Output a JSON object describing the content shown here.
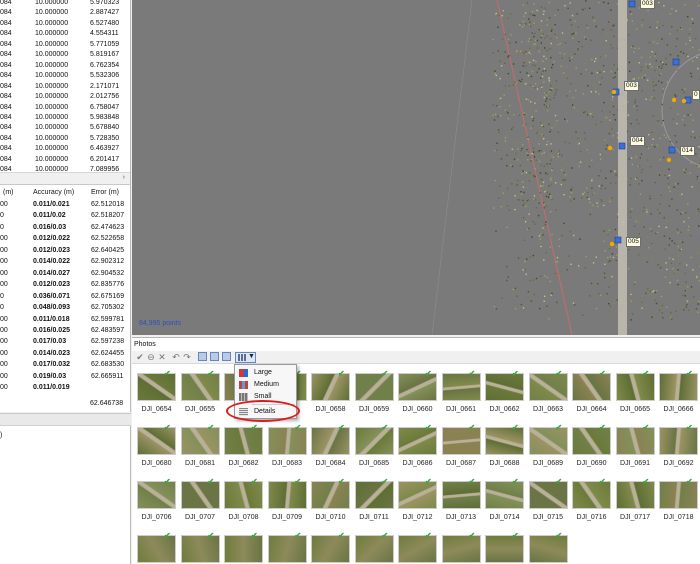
{
  "left_top_rows": [
    {
      "c1": "084",
      "c2": "10.000000",
      "c3": "5.970323"
    },
    {
      "c1": "084",
      "c2": "10.000000",
      "c3": "2.887427"
    },
    {
      "c1": "084",
      "c2": "10.000000",
      "c3": "6.527480"
    },
    {
      "c1": "084",
      "c2": "10.000000",
      "c3": "4.554311"
    },
    {
      "c1": "084",
      "c2": "10.000000",
      "c3": "5.771059"
    },
    {
      "c1": "084",
      "c2": "10.000000",
      "c3": "5.819167"
    },
    {
      "c1": "084",
      "c2": "10.000000",
      "c3": "6.762354"
    },
    {
      "c1": "084",
      "c2": "10.000000",
      "c3": "5.532306"
    },
    {
      "c1": "084",
      "c2": "10.000000",
      "c3": "2.171071"
    },
    {
      "c1": "084",
      "c2": "10.000000",
      "c3": "2.012756"
    },
    {
      "c1": "084",
      "c2": "10.000000",
      "c3": "6.758047"
    },
    {
      "c1": "084",
      "c2": "10.000000",
      "c3": "5.983848"
    },
    {
      "c1": "084",
      "c2": "10.000000",
      "c3": "5.678840"
    },
    {
      "c1": "084",
      "c2": "10.000000",
      "c3": "5.728350"
    },
    {
      "c1": "084",
      "c2": "10.000000",
      "c3": "6.463927"
    },
    {
      "c1": "084",
      "c2": "10.000000",
      "c3": "6.201417"
    },
    {
      "c1": "084",
      "c2": "10.000000",
      "c3": "7.089956"
    }
  ],
  "left_top_scroll_arrow": "›",
  "gcp_table": {
    "headers": {
      "c1": "(m)",
      "c2": "Accuracy (m)",
      "c3": "Error (m)"
    },
    "rows": [
      {
        "c1": "00",
        "c2": "0.011/0.021",
        "c3": "62.512018"
      },
      {
        "c1": "0",
        "c2": "0.011/0.02",
        "c3": "62.518207"
      },
      {
        "c1": "0",
        "c2": "0.016/0.03",
        "c3": "62.474623"
      },
      {
        "c1": "00",
        "c2": "0.012/0.022",
        "c3": "62.522658"
      },
      {
        "c1": "00",
        "c2": "0.012/0.023",
        "c3": "62.640425"
      },
      {
        "c1": "00",
        "c2": "0.014/0.022",
        "c3": "62.902312"
      },
      {
        "c1": "00",
        "c2": "0.014/0.027",
        "c3": "62.904532"
      },
      {
        "c1": "00",
        "c2": "0.012/0.023",
        "c3": "62.835776"
      },
      {
        "c1": "0",
        "c2": "0.036/0.071",
        "c3": "62.675169"
      },
      {
        "c1": "0",
        "c2": "0.048/0.093",
        "c3": "62.705302"
      },
      {
        "c1": "00",
        "c2": "0.011/0.018",
        "c3": "62.599781"
      },
      {
        "c1": "00",
        "c2": "0.016/0.025",
        "c3": "62.483597"
      },
      {
        "c1": "00",
        "c2": "0.017/0.03",
        "c3": "62.597238"
      },
      {
        "c1": "00",
        "c2": "0.014/0.023",
        "c3": "62.624455"
      },
      {
        "c1": "00",
        "c2": "0.017/0.032",
        "c3": "62.683530"
      },
      {
        "c1": "00",
        "c2": "0.019/0.03",
        "c3": "62.665911"
      },
      {
        "c1": "00",
        "c2": "0.011/0.019",
        "c3": ""
      }
    ],
    "total": "62.646738"
  },
  "left_bottom_text": ")",
  "viewport": {
    "point_count": "84,995 points",
    "camera_labels": [
      "003",
      "003",
      "004",
      "004",
      "005",
      "005",
      "014",
      "0"
    ]
  },
  "photos": {
    "title": "Photos",
    "menu": {
      "items": [
        "Large",
        "Medium",
        "Small",
        "Details"
      ]
    },
    "thumb_check": "✔",
    "row_labels": [
      [
        "DJI_0654",
        "DJI_0655",
        "",
        "7",
        "DJI_0658",
        "DJI_0659",
        "DJI_0660",
        "DJI_0661",
        "DJI_0662",
        "DJI_0663",
        "DJI_0664",
        "DJI_0665",
        "DJI_0666"
      ],
      [
        "DJI_0680",
        "DJI_0681",
        "DJI_0682",
        "DJI_0683",
        "DJI_0684",
        "DJI_0685",
        "DJI_0686",
        "DJI_0687",
        "DJI_0688",
        "DJI_0689",
        "DJI_0690",
        "DJI_0691",
        "DJI_0692"
      ],
      [
        "DJI_0706",
        "DJI_0707",
        "DJI_0708",
        "DJI_0709",
        "DJI_0710",
        "DJI_0711",
        "DJI_0712",
        "DJI_0713",
        "DJI_0714",
        "DJI_0715",
        "DJI_0716",
        "DJI_0717",
        "DJI_0718"
      ]
    ]
  }
}
